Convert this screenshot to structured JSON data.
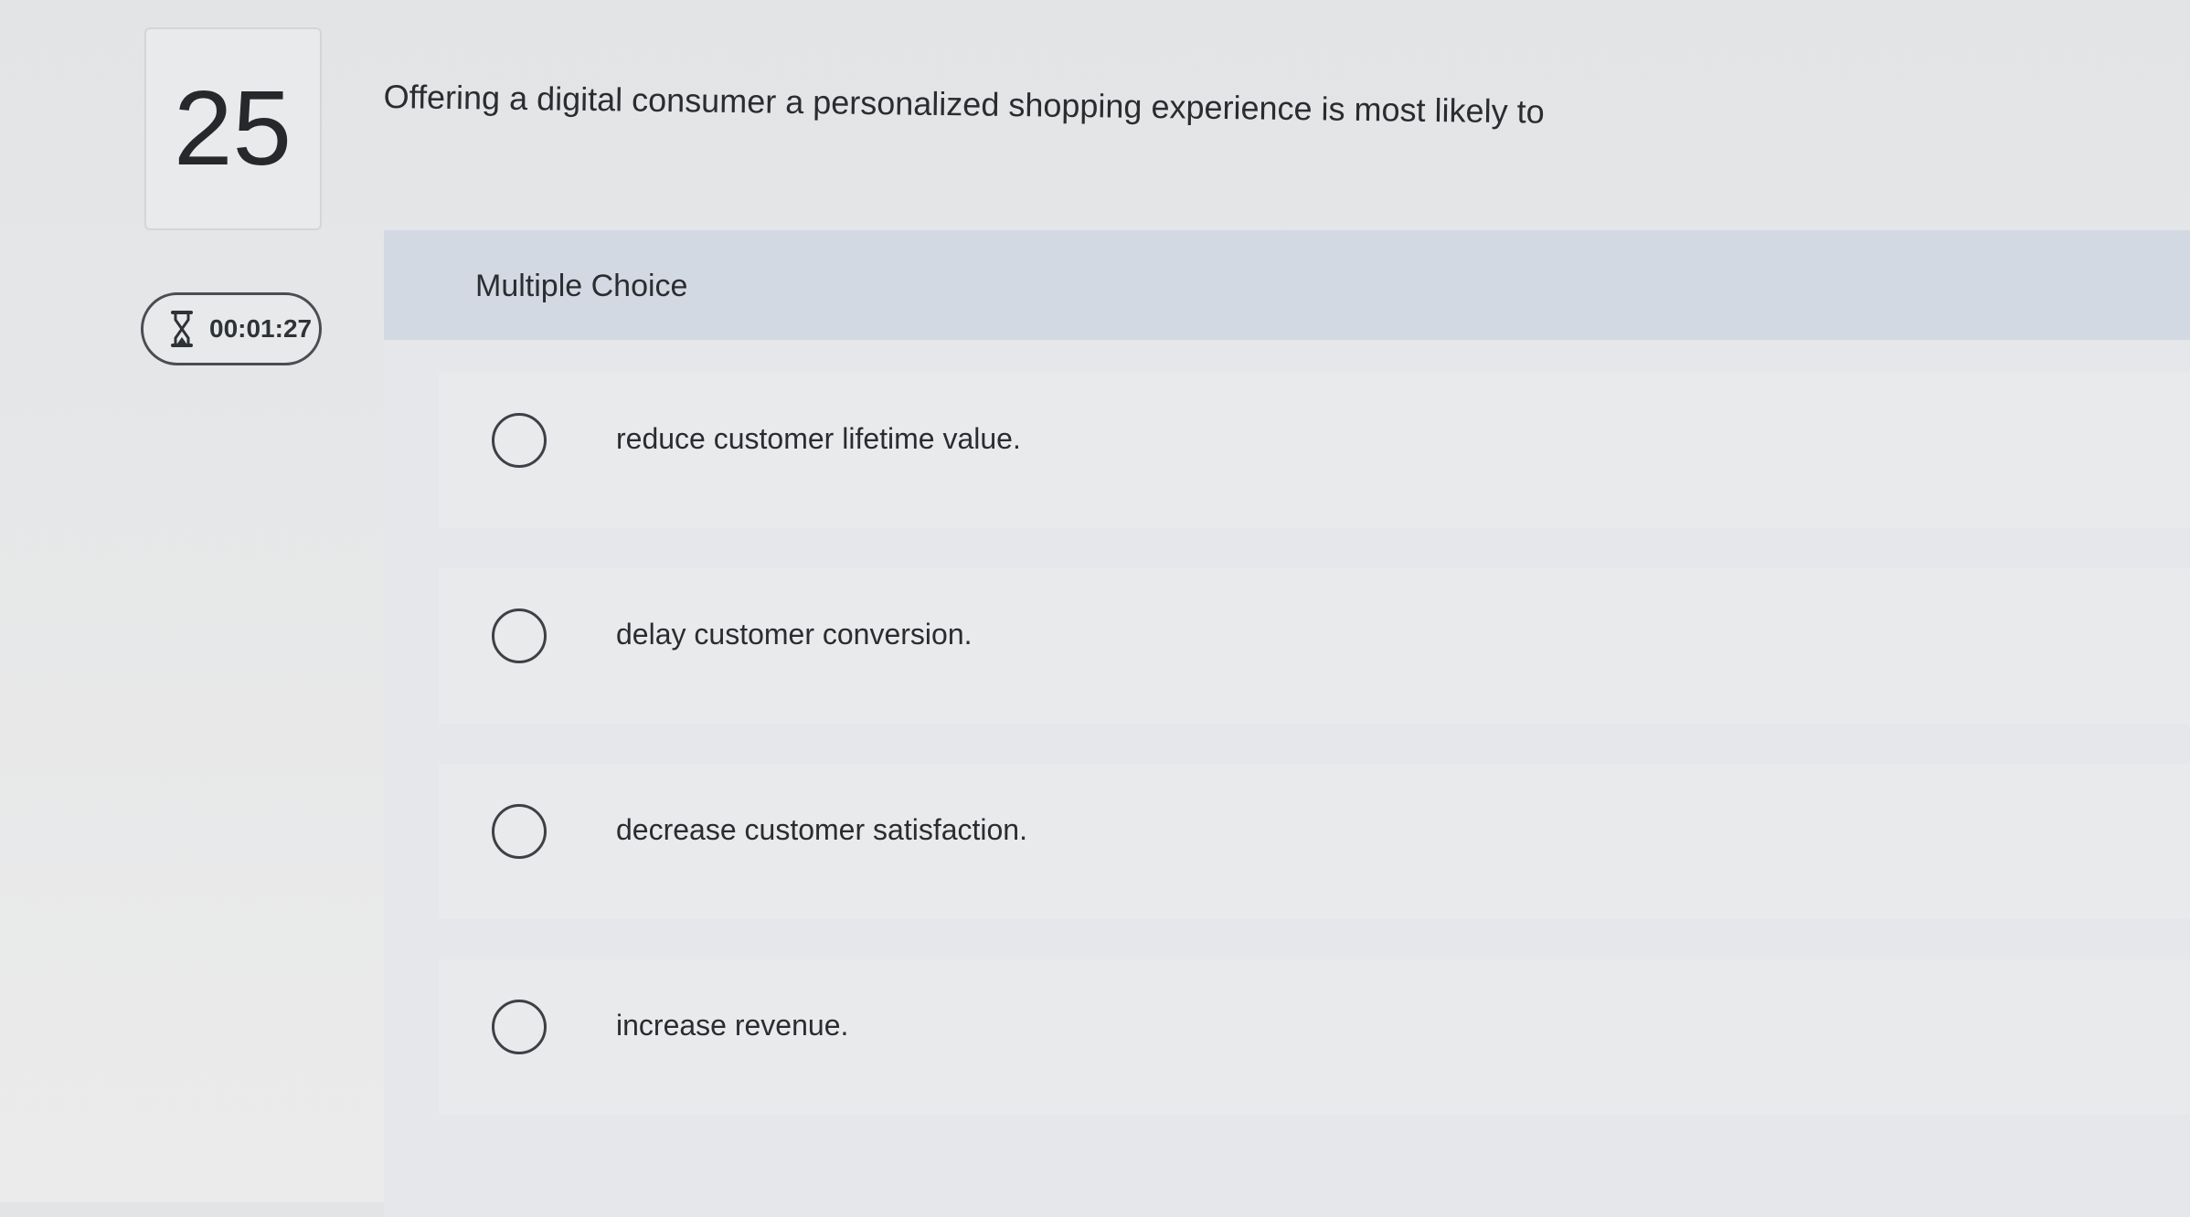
{
  "question": {
    "number": "25",
    "prompt": "Offering a digital consumer a personalized shopping experience is most likely to"
  },
  "timer": {
    "icon": "hourglass-icon",
    "value": "00:01:27"
  },
  "answer_section": {
    "type_label": "Multiple Choice",
    "options": [
      {
        "label": "reduce customer lifetime value."
      },
      {
        "label": "delay customer conversion."
      },
      {
        "label": "decrease customer satisfaction."
      },
      {
        "label": "increase revenue."
      }
    ]
  }
}
